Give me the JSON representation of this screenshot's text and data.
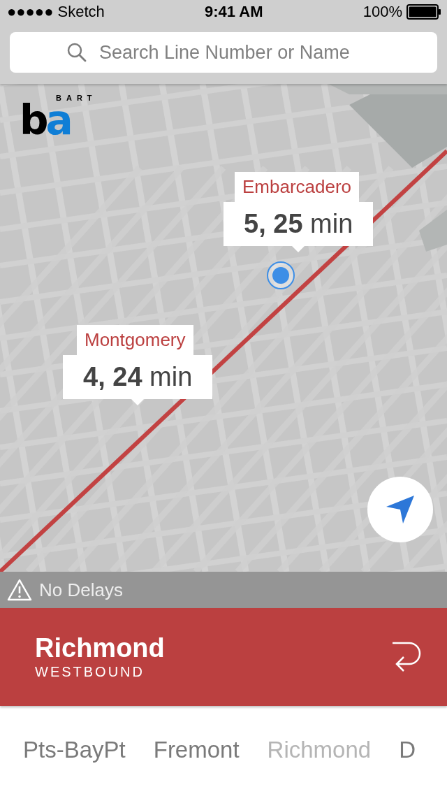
{
  "status_bar": {
    "carrier": "●●●●● Sketch",
    "time": "9:41 AM",
    "battery": "100%"
  },
  "search": {
    "placeholder": "Search Line Number or Name"
  },
  "logo": {
    "top": "BART",
    "mark": "ba"
  },
  "map": {
    "kind": "picture",
    "stations": [
      {
        "name": "Embarcadero",
        "times": "**5, 25** min"
      },
      {
        "name": "Montgomery",
        "times": "**4, 24** min"
      }
    ]
  },
  "alert": {
    "text": "No Delays"
  },
  "line": {
    "name": "Richmond",
    "direction": "WESTBOUND"
  },
  "tabs": [
    {
      "label": "Pts-BayPt",
      "selected": false
    },
    {
      "label": "Fremont",
      "selected": false
    },
    {
      "label": "Richmond",
      "selected": true
    },
    {
      "label": "D",
      "selected": false
    }
  ]
}
